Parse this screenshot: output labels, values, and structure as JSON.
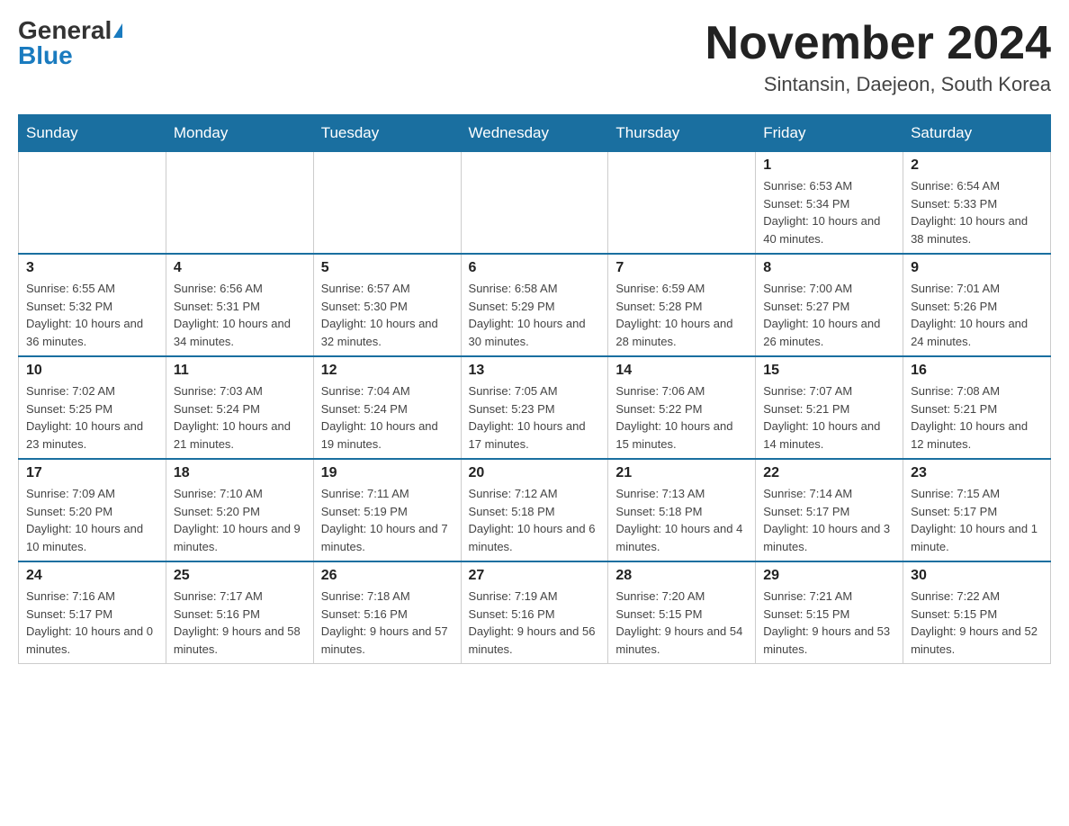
{
  "header": {
    "logo_general": "General",
    "logo_blue": "Blue",
    "month_title": "November 2024",
    "subtitle": "Sintansin, Daejeon, South Korea"
  },
  "weekdays": [
    "Sunday",
    "Monday",
    "Tuesday",
    "Wednesday",
    "Thursday",
    "Friday",
    "Saturday"
  ],
  "weeks": [
    [
      {
        "day": "",
        "info": ""
      },
      {
        "day": "",
        "info": ""
      },
      {
        "day": "",
        "info": ""
      },
      {
        "day": "",
        "info": ""
      },
      {
        "day": "",
        "info": ""
      },
      {
        "day": "1",
        "info": "Sunrise: 6:53 AM\nSunset: 5:34 PM\nDaylight: 10 hours and 40 minutes."
      },
      {
        "day": "2",
        "info": "Sunrise: 6:54 AM\nSunset: 5:33 PM\nDaylight: 10 hours and 38 minutes."
      }
    ],
    [
      {
        "day": "3",
        "info": "Sunrise: 6:55 AM\nSunset: 5:32 PM\nDaylight: 10 hours and 36 minutes."
      },
      {
        "day": "4",
        "info": "Sunrise: 6:56 AM\nSunset: 5:31 PM\nDaylight: 10 hours and 34 minutes."
      },
      {
        "day": "5",
        "info": "Sunrise: 6:57 AM\nSunset: 5:30 PM\nDaylight: 10 hours and 32 minutes."
      },
      {
        "day": "6",
        "info": "Sunrise: 6:58 AM\nSunset: 5:29 PM\nDaylight: 10 hours and 30 minutes."
      },
      {
        "day": "7",
        "info": "Sunrise: 6:59 AM\nSunset: 5:28 PM\nDaylight: 10 hours and 28 minutes."
      },
      {
        "day": "8",
        "info": "Sunrise: 7:00 AM\nSunset: 5:27 PM\nDaylight: 10 hours and 26 minutes."
      },
      {
        "day": "9",
        "info": "Sunrise: 7:01 AM\nSunset: 5:26 PM\nDaylight: 10 hours and 24 minutes."
      }
    ],
    [
      {
        "day": "10",
        "info": "Sunrise: 7:02 AM\nSunset: 5:25 PM\nDaylight: 10 hours and 23 minutes."
      },
      {
        "day": "11",
        "info": "Sunrise: 7:03 AM\nSunset: 5:24 PM\nDaylight: 10 hours and 21 minutes."
      },
      {
        "day": "12",
        "info": "Sunrise: 7:04 AM\nSunset: 5:24 PM\nDaylight: 10 hours and 19 minutes."
      },
      {
        "day": "13",
        "info": "Sunrise: 7:05 AM\nSunset: 5:23 PM\nDaylight: 10 hours and 17 minutes."
      },
      {
        "day": "14",
        "info": "Sunrise: 7:06 AM\nSunset: 5:22 PM\nDaylight: 10 hours and 15 minutes."
      },
      {
        "day": "15",
        "info": "Sunrise: 7:07 AM\nSunset: 5:21 PM\nDaylight: 10 hours and 14 minutes."
      },
      {
        "day": "16",
        "info": "Sunrise: 7:08 AM\nSunset: 5:21 PM\nDaylight: 10 hours and 12 minutes."
      }
    ],
    [
      {
        "day": "17",
        "info": "Sunrise: 7:09 AM\nSunset: 5:20 PM\nDaylight: 10 hours and 10 minutes."
      },
      {
        "day": "18",
        "info": "Sunrise: 7:10 AM\nSunset: 5:20 PM\nDaylight: 10 hours and 9 minutes."
      },
      {
        "day": "19",
        "info": "Sunrise: 7:11 AM\nSunset: 5:19 PM\nDaylight: 10 hours and 7 minutes."
      },
      {
        "day": "20",
        "info": "Sunrise: 7:12 AM\nSunset: 5:18 PM\nDaylight: 10 hours and 6 minutes."
      },
      {
        "day": "21",
        "info": "Sunrise: 7:13 AM\nSunset: 5:18 PM\nDaylight: 10 hours and 4 minutes."
      },
      {
        "day": "22",
        "info": "Sunrise: 7:14 AM\nSunset: 5:17 PM\nDaylight: 10 hours and 3 minutes."
      },
      {
        "day": "23",
        "info": "Sunrise: 7:15 AM\nSunset: 5:17 PM\nDaylight: 10 hours and 1 minute."
      }
    ],
    [
      {
        "day": "24",
        "info": "Sunrise: 7:16 AM\nSunset: 5:17 PM\nDaylight: 10 hours and 0 minutes."
      },
      {
        "day": "25",
        "info": "Sunrise: 7:17 AM\nSunset: 5:16 PM\nDaylight: 9 hours and 58 minutes."
      },
      {
        "day": "26",
        "info": "Sunrise: 7:18 AM\nSunset: 5:16 PM\nDaylight: 9 hours and 57 minutes."
      },
      {
        "day": "27",
        "info": "Sunrise: 7:19 AM\nSunset: 5:16 PM\nDaylight: 9 hours and 56 minutes."
      },
      {
        "day": "28",
        "info": "Sunrise: 7:20 AM\nSunset: 5:15 PM\nDaylight: 9 hours and 54 minutes."
      },
      {
        "day": "29",
        "info": "Sunrise: 7:21 AM\nSunset: 5:15 PM\nDaylight: 9 hours and 53 minutes."
      },
      {
        "day": "30",
        "info": "Sunrise: 7:22 AM\nSunset: 5:15 PM\nDaylight: 9 hours and 52 minutes."
      }
    ]
  ]
}
